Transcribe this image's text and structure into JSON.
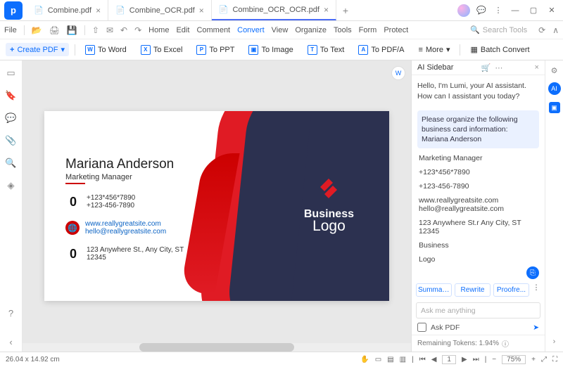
{
  "tabs": [
    {
      "label": "Combine.pdf"
    },
    {
      "label": "Combine_OCR.pdf"
    },
    {
      "label": "Combine_OCR_OCR.pdf"
    }
  ],
  "menu": {
    "file": "File",
    "home": "Home",
    "edit": "Edit",
    "comment": "Comment",
    "convert": "Convert",
    "view": "View",
    "organize": "Organize",
    "tools": "Tools",
    "form": "Form",
    "protect": "Protect"
  },
  "search": {
    "placeholder": "Search Tools"
  },
  "toolbar": {
    "create": "Create PDF",
    "toWord": "To Word",
    "toExcel": "To Excel",
    "toPPT": "To PPT",
    "toImage": "To Image",
    "toText": "To Text",
    "toPDFA": "To PDF/A",
    "more": "More",
    "batch": "Batch Convert"
  },
  "card": {
    "name": "Mariana Anderson",
    "role": "Marketing Manager",
    "phone1": "+123*456*7890",
    "phone2": "+123-456-7890",
    "site": "www.reallygreatsite.com",
    "email": "hello@reallygreatsite.com",
    "addr1": "123 Anywhere St., Any City, ST",
    "addr2": "12345",
    "brand1": "Business",
    "brand2": "Logo"
  },
  "ai": {
    "title": "AI Sidebar",
    "greet": "Hello, I'm Lumi, your AI assistant. How can I assistant you today?",
    "userMsg": "Please organize the following business card information:\nMariana Anderson",
    "lines": [
      "Marketing Manager",
      "+123*456*7890",
      "+123-456-7890",
      "www.reallygreatsite.com\nhello@reallygreatsite.com",
      "123 Anywhere St.r Any City, ST\n12345",
      "Business",
      "Logo"
    ],
    "actions": [
      "Summar...",
      "Rewrite",
      "Proofre..."
    ],
    "askPlaceholder": "Ask me anything",
    "askPDF": "Ask PDF",
    "tokens": "Remaining Tokens: 1.94%"
  },
  "status": {
    "dim": "26.04 x 14.92 cm",
    "zoom": "75%"
  }
}
